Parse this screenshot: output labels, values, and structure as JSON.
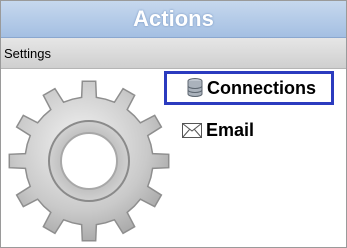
{
  "header": {
    "title": "Actions"
  },
  "settings": {
    "label": "Settings"
  },
  "actions": [
    {
      "label": "Connections",
      "icon": "database-icon",
      "selected": true
    },
    {
      "label": "Email",
      "icon": "envelope-icon",
      "selected": false
    }
  ],
  "decor": {
    "icon": "gear-icon"
  },
  "colors": {
    "header": "#b2c9e8",
    "selection_border": "#2b3bbf",
    "settings_bar": "#dadada"
  }
}
